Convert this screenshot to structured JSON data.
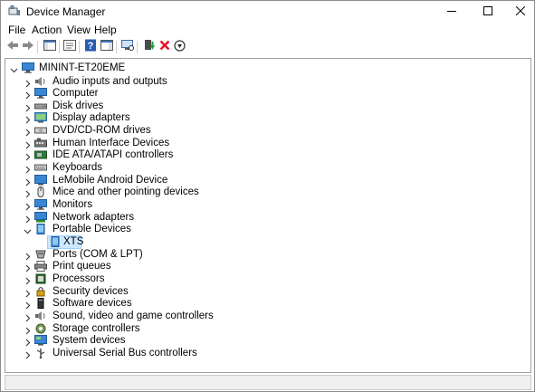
{
  "window": {
    "title": "Device Manager",
    "title_icon": "device-manager-icon",
    "controls": {
      "minimize": "minimize-icon",
      "maximize": "maximize-icon",
      "close": "close-icon"
    }
  },
  "menu": {
    "items": [
      {
        "label": "File"
      },
      {
        "label": "Action"
      },
      {
        "label": "View"
      },
      {
        "label": "Help"
      }
    ]
  },
  "toolbar": {
    "buttons": [
      "back-icon",
      "forward-icon",
      "show-hide-console-tree-icon",
      "properties-icon",
      "help-icon",
      "action-pane-icon",
      "scan-hardware-icon",
      "update-driver-icon",
      "uninstall-icon",
      "disable-device-icon"
    ]
  },
  "tree": {
    "root": {
      "label": "MININT-ET20EME",
      "expanded": true
    },
    "categories": [
      {
        "label": "Audio inputs and outputs",
        "icon": "speaker-icon",
        "expanded": false
      },
      {
        "label": "Computer",
        "icon": "computer-icon",
        "expanded": false
      },
      {
        "label": "Disk drives",
        "icon": "disk-drive-icon",
        "expanded": false
      },
      {
        "label": "Display adapters",
        "icon": "display-adapter-icon",
        "expanded": false
      },
      {
        "label": "DVD/CD-ROM drives",
        "icon": "dvd-drive-icon",
        "expanded": false
      },
      {
        "label": "Human Interface Devices",
        "icon": "hid-icon",
        "expanded": false
      },
      {
        "label": "IDE ATA/ATAPI controllers",
        "icon": "ide-controller-icon",
        "expanded": false
      },
      {
        "label": "Keyboards",
        "icon": "keyboard-icon",
        "expanded": false
      },
      {
        "label": "LeMobile Android Device",
        "icon": "android-device-icon",
        "expanded": false
      },
      {
        "label": "Mice and other pointing devices",
        "icon": "mouse-icon",
        "expanded": false
      },
      {
        "label": "Monitors",
        "icon": "monitor-icon",
        "expanded": false
      },
      {
        "label": "Network adapters",
        "icon": "network-adapter-icon",
        "expanded": false
      },
      {
        "label": "Portable Devices",
        "icon": "portable-device-icon",
        "expanded": true,
        "children": [
          {
            "label": "XTS",
            "icon": "portable-device-icon",
            "selected": true
          }
        ]
      },
      {
        "label": "Ports (COM & LPT)",
        "icon": "port-icon",
        "expanded": false
      },
      {
        "label": "Print queues",
        "icon": "printer-icon",
        "expanded": false
      },
      {
        "label": "Processors",
        "icon": "processor-icon",
        "expanded": false
      },
      {
        "label": "Security devices",
        "icon": "security-device-icon",
        "expanded": false
      },
      {
        "label": "Software devices",
        "icon": "software-device-icon",
        "expanded": false
      },
      {
        "label": "Sound, video and game controllers",
        "icon": "sound-controller-icon",
        "expanded": false
      },
      {
        "label": "Storage controllers",
        "icon": "storage-controller-icon",
        "expanded": false
      },
      {
        "label": "System devices",
        "icon": "system-device-icon",
        "expanded": false
      },
      {
        "label": "Universal Serial Bus controllers",
        "icon": "usb-icon",
        "expanded": false
      }
    ]
  },
  "colors": {
    "selection_bg": "#cce8ff",
    "selection_border": "#99d1ff",
    "icon_blue": "#1e78c8",
    "delete_red": "#e81123",
    "scan_green": "#1e9e3c"
  }
}
